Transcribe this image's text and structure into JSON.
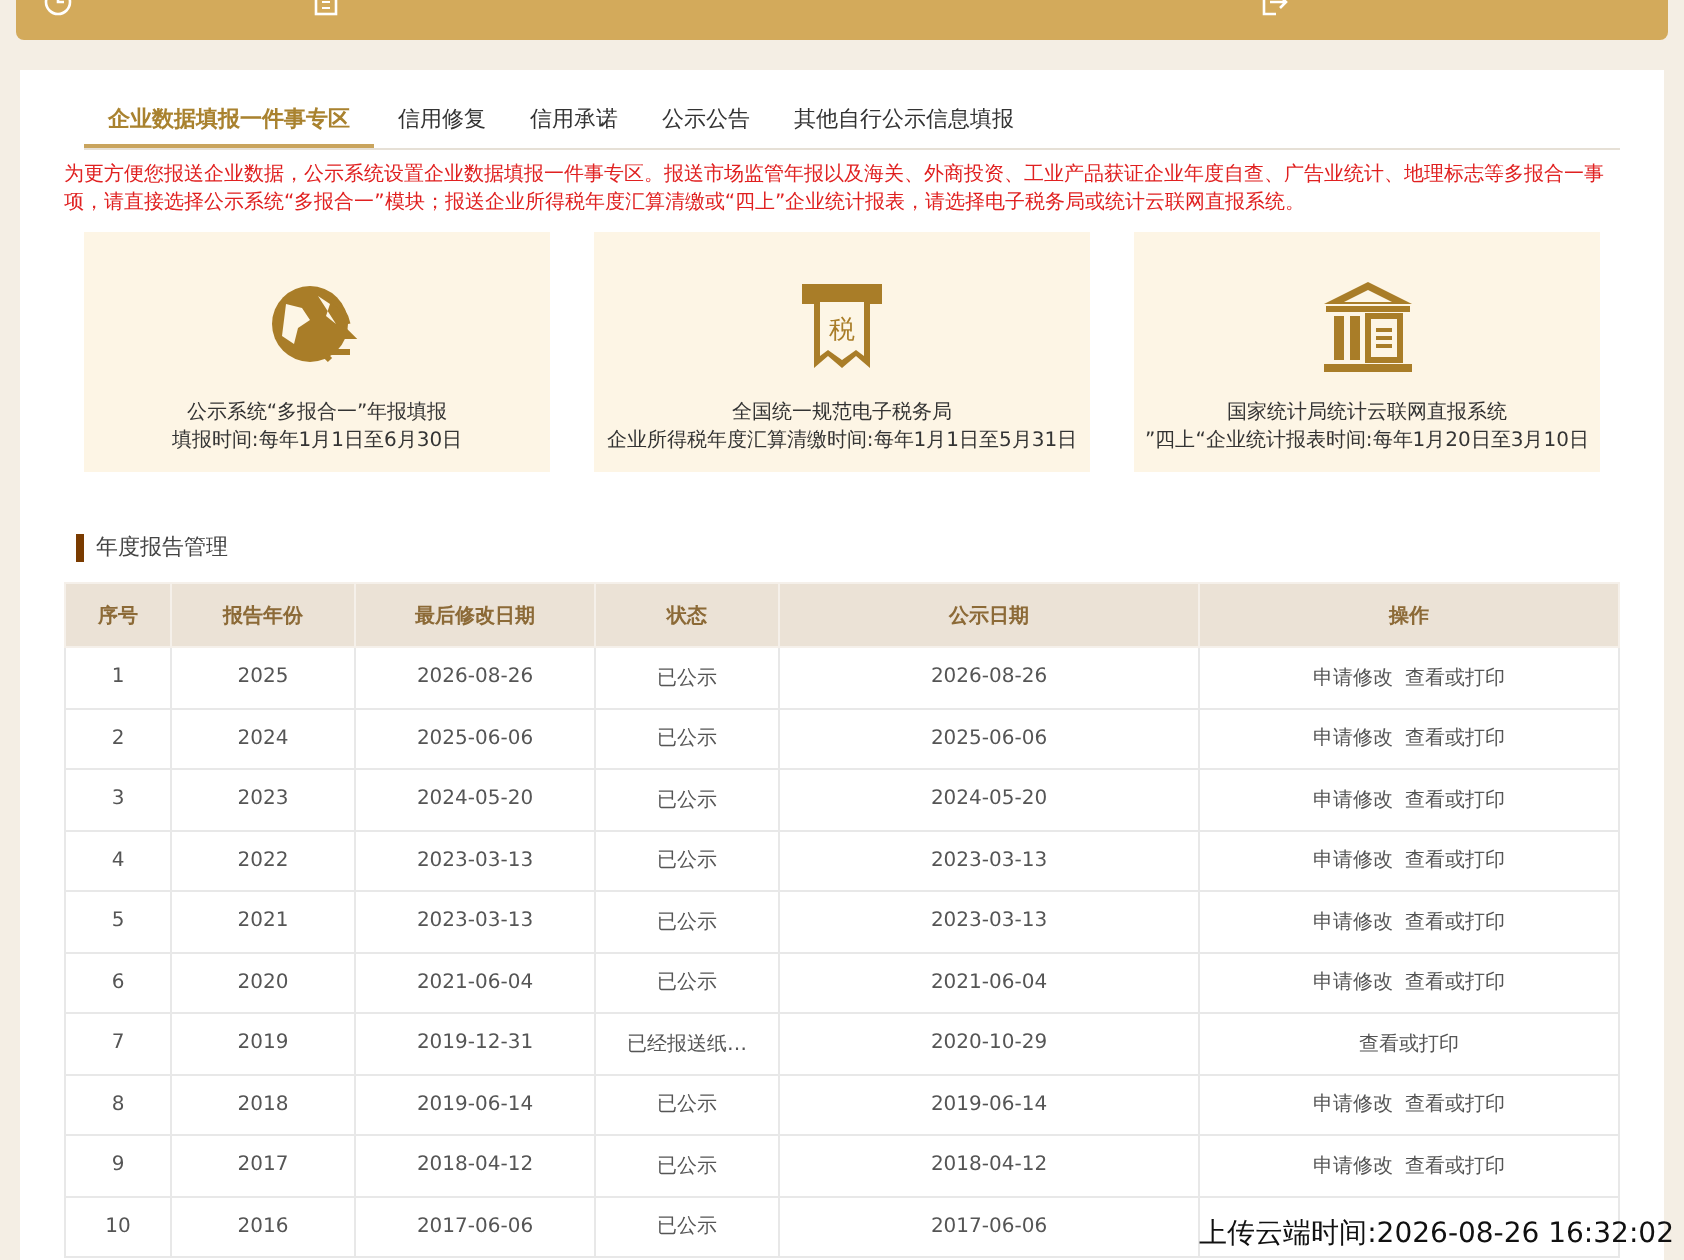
{
  "tabs": [
    {
      "label": "企业数据填报一件事专区",
      "selected": true
    },
    {
      "label": "信用修复",
      "selected": false
    },
    {
      "label": "信用承诺",
      "selected": false
    },
    {
      "label": "公示公告",
      "selected": false
    },
    {
      "label": "其他自行公示信息填报",
      "selected": false
    }
  ],
  "notice": "为更方便您报送企业数据，公示系统设置企业数据填报一件事专区。报送市场监管年报以及海关、外商投资、工业产品获证企业年度自查、广告业统计、地理标志等多报合一事项，请直接选择公示系统“多报合一”模块；报送企业所得税年度汇算清缴或“四上”企业统计报表，请选择电子税务局或统计云联网直报系统。",
  "services": [
    {
      "kind": "globe",
      "title": "公示系统“多报合一”年报填报",
      "period": "填报时间:每年1月1日至6月30日"
    },
    {
      "kind": "tax",
      "icon_text": "税",
      "title": "全国统一规范电子税务局",
      "period": "企业所得税年度汇算清缴时间:每年1月1日至5月31日"
    },
    {
      "kind": "bank",
      "title": "国家统计局统计云联网直报系统",
      "period": "”四上“企业统计报表时间:每年1月20日至3月10日"
    }
  ],
  "section_title": "年度报告管理",
  "table": {
    "columns": [
      "序号",
      "报告年份",
      "最后修改日期",
      "状态",
      "公示日期",
      "操作"
    ],
    "rows": [
      {
        "no": "1",
        "year": "2025",
        "modified": "2026-08-26",
        "status": "已公示",
        "published": "2026-08-26",
        "actions": [
          "申请修改",
          "查看或打印"
        ]
      },
      {
        "no": "2",
        "year": "2024",
        "modified": "2025-06-06",
        "status": "已公示",
        "published": "2025-06-06",
        "actions": [
          "申请修改",
          "查看或打印"
        ]
      },
      {
        "no": "3",
        "year": "2023",
        "modified": "2024-05-20",
        "status": "已公示",
        "published": "2024-05-20",
        "actions": [
          "申请修改",
          "查看或打印"
        ]
      },
      {
        "no": "4",
        "year": "2022",
        "modified": "2023-03-13",
        "status": "已公示",
        "published": "2023-03-13",
        "actions": [
          "申请修改",
          "查看或打印"
        ]
      },
      {
        "no": "5",
        "year": "2021",
        "modified": "2023-03-13",
        "status": "已公示",
        "published": "2023-03-13",
        "actions": [
          "申请修改",
          "查看或打印"
        ]
      },
      {
        "no": "6",
        "year": "2020",
        "modified": "2021-06-04",
        "status": "已公示",
        "published": "2021-06-04",
        "actions": [
          "申请修改",
          "查看或打印"
        ]
      },
      {
        "no": "7",
        "year": "2019",
        "modified": "2019-12-31",
        "status": "已经报送纸…",
        "published": "2020-10-29",
        "actions": [
          "查看或打印"
        ]
      },
      {
        "no": "8",
        "year": "2018",
        "modified": "2019-06-14",
        "status": "已公示",
        "published": "2019-06-14",
        "actions": [
          "申请修改",
          "查看或打印"
        ]
      },
      {
        "no": "9",
        "year": "2017",
        "modified": "2018-04-12",
        "status": "已公示",
        "published": "2018-04-12",
        "actions": [
          "申请修改",
          "查看或打印"
        ]
      },
      {
        "no": "10",
        "year": "2016",
        "modified": "2017-06-06",
        "status": "已公示",
        "published": "2017-06-06"
      }
    ]
  },
  "stamp": "上传云端时间:2026-08-26 16:32:02"
}
